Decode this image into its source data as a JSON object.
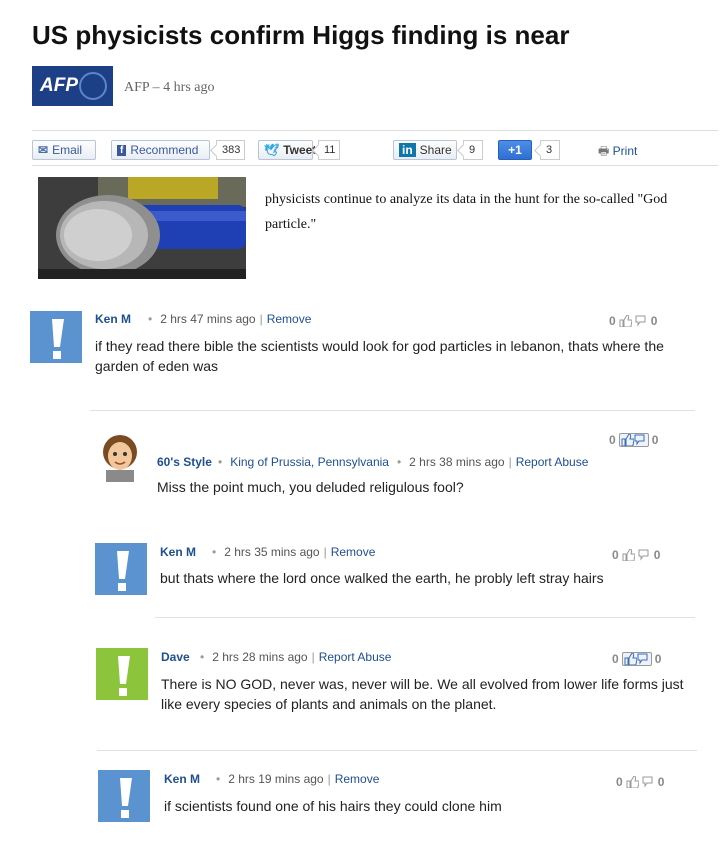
{
  "article": {
    "headline": "US physicists confirm Higgs finding is near",
    "logo_text": "AFP",
    "byline": "AFP – 4 hrs ago",
    "caption": "physicists continue to analyze its data in the hunt for the so-called \"God particle.\""
  },
  "toolbar": {
    "email": "Email",
    "recommend": "Recommend",
    "recommend_count": "383",
    "tweet": "Tweet",
    "tweet_count": "11",
    "share": "Share",
    "share_count": "9",
    "plusone": "+1",
    "plusone_count": "3",
    "print": "Print"
  },
  "comments": [
    {
      "name": "Ken M",
      "time": "2 hrs 47 mins ago",
      "action": "Remove",
      "text": "if they read there bible the scientists would look for god particles in lebanon, thats where the garden of eden was",
      "up": "0",
      "down": "0",
      "avatar": "exclamation-blue"
    },
    {
      "name": "60's Style",
      "location": "King of Prussia, Pennsylvania",
      "time": "2 hrs 38 mins ago",
      "action": "Report Abuse",
      "text": "Miss the point much, you deluded religulous fool?",
      "up": "0",
      "down": "0",
      "avatar": "cartoon-person"
    },
    {
      "name": "Ken M",
      "time": "2 hrs 35 mins ago",
      "action": "Remove",
      "text": "but thats where the lord once walked the earth, he probly left stray hairs",
      "up": "0",
      "down": "0",
      "avatar": "exclamation-blue"
    },
    {
      "name": "Dave",
      "time": "2 hrs 28 mins ago",
      "action": "Report Abuse",
      "text": "There is NO GOD, never was, never will be. We all evolved from lower life forms just like every species of plants and animals on the planet.",
      "up": "0",
      "down": "0",
      "avatar": "exclamation-green"
    },
    {
      "name": "Ken M",
      "time": "2 hrs 19 mins ago",
      "action": "Remove",
      "text": "if scientists found one of his hairs they could clone him",
      "up": "0",
      "down": "0",
      "avatar": "exclamation-blue"
    }
  ],
  "colors": {
    "link": "#1f4f8f",
    "avatar_blue": "#5a93cf",
    "avatar_green": "#8cc43c",
    "afp_blue": "#1d3f86"
  }
}
